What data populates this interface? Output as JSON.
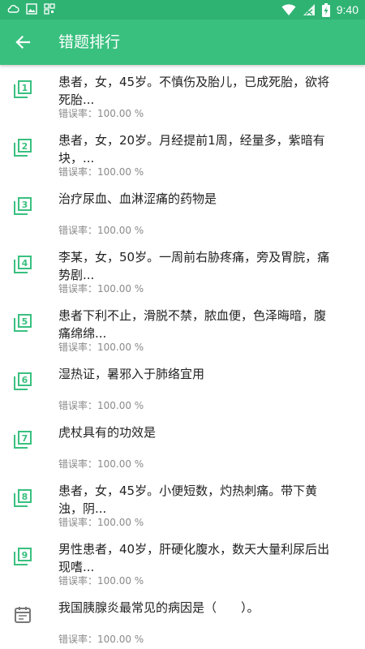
{
  "status_bar": {
    "time": "9:40"
  },
  "app_bar": {
    "title": "错题排行"
  },
  "colors": {
    "accent": "#39c07f",
    "status": "#2fb373",
    "icon": "#39c07f",
    "calendar_icon": "#777777"
  },
  "items": [
    {
      "number": "1",
      "title_line1": "患者，女，45岁。不慎伤及胎儿，已成死胎，欲将",
      "title_line2": "死胎...",
      "error_rate": "错误率：100.00 %"
    },
    {
      "number": "2",
      "title_line1": "患者，女，20岁。月经提前1周，经量多，紫暗有",
      "title_line2": "块，...",
      "error_rate": "错误率：100.00 %"
    },
    {
      "number": "3",
      "title_line1": "治疗尿血、血淋涩痛的药物是",
      "title_line2": "",
      "error_rate": "错误率：100.00 %"
    },
    {
      "number": "4",
      "title_line1": "李某，女，50岁。一周前右胁疼痛，旁及胃脘，痛",
      "title_line2": "势剧...",
      "error_rate": "错误率：100.00 %"
    },
    {
      "number": "5",
      "title_line1": "患者下利不止，滑脱不禁，脓血便，色泽晦暗，腹",
      "title_line2": "痛绵绵...",
      "error_rate": "错误率：100.00 %"
    },
    {
      "number": "6",
      "title_line1": "湿热证，暑邪入于肺络宜用",
      "title_line2": "",
      "error_rate": "错误率：100.00 %"
    },
    {
      "number": "7",
      "title_line1": "虎杖具有的功效是",
      "title_line2": "",
      "error_rate": "错误率：100.00 %"
    },
    {
      "number": "8",
      "title_line1": "患者，女，45岁。小便短数，灼热刺痛。带下黄",
      "title_line2": "浊，阴...",
      "error_rate": "错误率：100.00 %"
    },
    {
      "number": "9",
      "title_line1": "男性患者，40岁，肝硬化腹水，数天大量利尿后出",
      "title_line2": "现嗜...",
      "error_rate": "错误率：100.00 %"
    },
    {
      "number": "",
      "title_line1": "我国胰腺炎最常见的病因是（　　）。",
      "title_line2": "",
      "error_rate": "错误率：100.00 %"
    }
  ]
}
